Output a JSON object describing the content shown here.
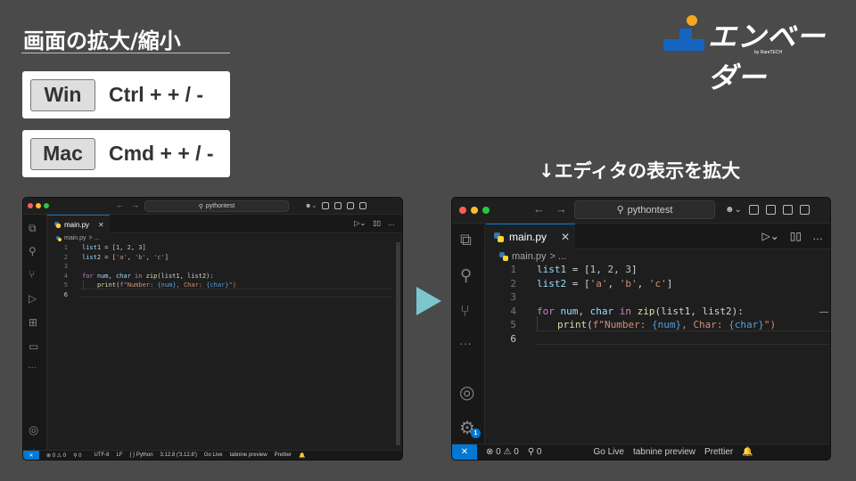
{
  "header": {
    "title": "画面の拡大/縮小",
    "shortcuts": [
      {
        "os": "Win",
        "keys": "Ctrl + + / -"
      },
      {
        "os": "Mac",
        "keys": "Cmd + + / -"
      }
    ]
  },
  "logo": {
    "text": "エンベーダー",
    "sub": "by RareTECH",
    "accent_color": "#f5a623",
    "brand_color": "#1565c0"
  },
  "caption": "↓エディタの表示を拡大",
  "editor": {
    "search_text": "pythontest",
    "tab_label": "main.py",
    "breadcrumb_file": "main.py",
    "breadcrumb_rest": "> ...",
    "line_numbers": [
      "1",
      "2",
      "3",
      "4",
      "5",
      "6"
    ],
    "code": {
      "l1_var": "list1",
      "l1_rest": " = [",
      "l1_n1": "1",
      "l1_c1": ", ",
      "l1_n2": "2",
      "l1_c2": ", ",
      "l1_n3": "3",
      "l1_end": "]",
      "l2_var": "list2",
      "l2_rest": " = [",
      "l2_s1": "'a'",
      "l2_c1": ", ",
      "l2_s2": "'b'",
      "l2_c2": ", ",
      "l2_s3": "'c'",
      "l2_end": "]",
      "l4_for": "for",
      "l4_vars": " num, char ",
      "l4_in": "in",
      "l4_zip": " zip",
      "l4_args": "(list1, list2):",
      "l5_print": "print",
      "l5_open": "(",
      "l5_f": "f\"Number: ",
      "l5_b1": "{num}",
      "l5_mid": ", Char: ",
      "l5_b2": "{char}",
      "l5_close": "\")"
    },
    "status_small": {
      "problems": "⊗ 0 ⚠ 0",
      "ports": "⚲ 0",
      "encoding": "UTF-8",
      "eol": "LF",
      "language": "{ } Python",
      "interpreter": "3.12.8 ('3.12.8')",
      "golive": "Go Live",
      "tabnine": "tabnine preview",
      "prettier": "Prettier"
    },
    "status_large": {
      "problems": "⊗ 0 ⚠ 0",
      "ports": "⚲ 0",
      "golive": "Go Live",
      "tabnine": "tabnine preview",
      "prettier": "Prettier"
    },
    "settings_badge": "1",
    "more": "···"
  }
}
